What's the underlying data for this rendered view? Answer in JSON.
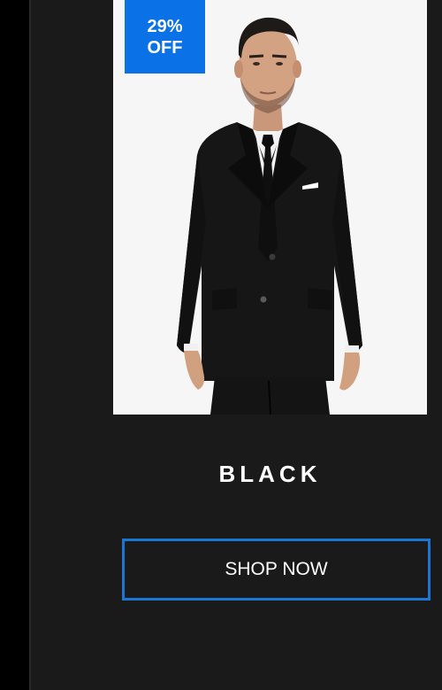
{
  "badge": {
    "percent": "29%",
    "label": "OFF",
    "color": "#0a72e6"
  },
  "product": {
    "image_alt": "Man wearing black suit with white shirt and black tie",
    "color_name": "BLACK"
  },
  "cta": {
    "label": "SHOP NOW",
    "border_color": "#1976d2"
  },
  "colors": {
    "background": "#1c1c1c",
    "image_background": "#f6f6f6",
    "text": "#ffffff"
  }
}
